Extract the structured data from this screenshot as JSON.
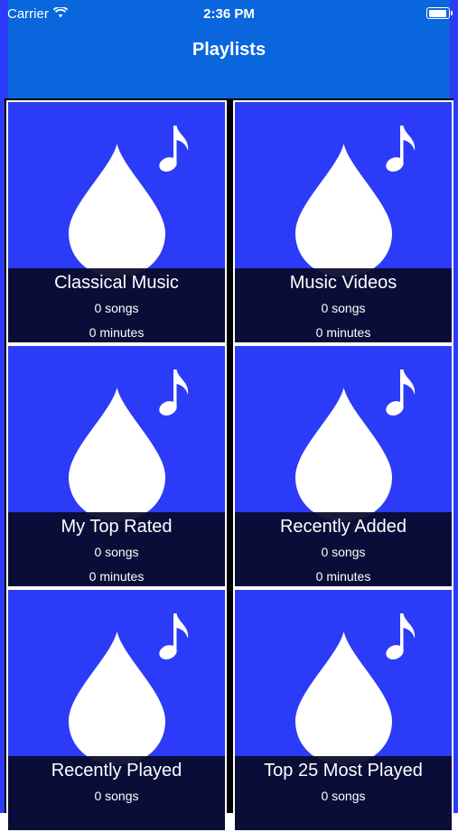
{
  "status_bar": {
    "carrier": "Carrier",
    "time": "2:36 PM",
    "wifi_icon": "wifi-icon",
    "battery_icon": "battery-icon"
  },
  "nav": {
    "title": "Playlists"
  },
  "colors": {
    "nav_bar": "#0a66dc",
    "tile_background": "#2b3bf7",
    "overlay": "#060a28",
    "divider": "#000000"
  },
  "playlists": [
    {
      "title": "Classical Music",
      "songs": "0 songs",
      "minutes": "0 minutes",
      "icon": "water-drop-icon",
      "badge": "music-note-icon"
    },
    {
      "title": "Music Videos",
      "songs": "0 songs",
      "minutes": "0 minutes",
      "icon": "water-drop-icon",
      "badge": "music-note-icon"
    },
    {
      "title": "My Top Rated",
      "songs": "0 songs",
      "minutes": "0 minutes",
      "icon": "water-drop-icon",
      "badge": "music-note-icon"
    },
    {
      "title": "Recently Added",
      "songs": "0 songs",
      "minutes": "0 minutes",
      "icon": "water-drop-icon",
      "badge": "music-note-icon"
    },
    {
      "title": "Recently Played",
      "songs": "0 songs",
      "minutes": "",
      "icon": "water-drop-icon",
      "badge": "music-note-icon"
    },
    {
      "title": "Top 25 Most Played",
      "songs": "0 songs",
      "minutes": "",
      "icon": "water-drop-icon",
      "badge": "music-note-icon"
    }
  ]
}
